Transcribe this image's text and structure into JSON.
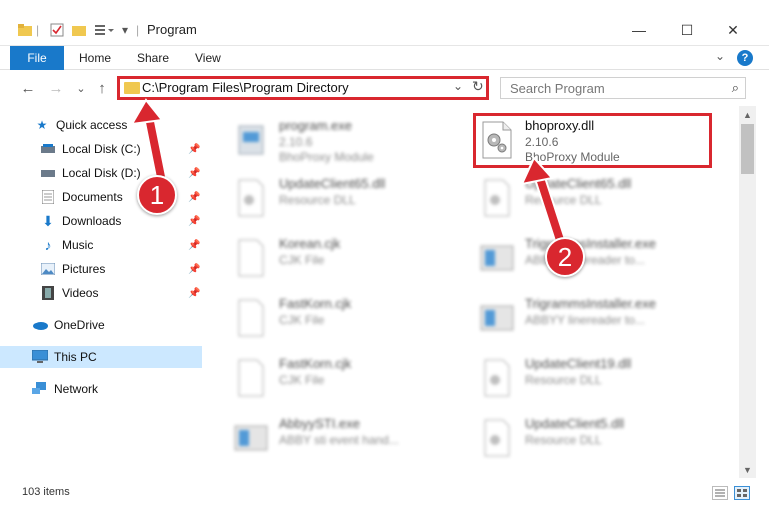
{
  "window": {
    "title": "Program",
    "minimize": "—",
    "maximize": "☐",
    "close": "✕"
  },
  "ribbon": {
    "file": "File",
    "home": "Home",
    "share": "Share",
    "view": "View",
    "help": "?",
    "expand": "⌄"
  },
  "navbar": {
    "back": "←",
    "forward": "→",
    "recent": "⌄",
    "up": "↑",
    "path": "C:\\Program Files\\Program Directory",
    "path_chevron": "⌄",
    "refresh": "↻",
    "search_placeholder": "Search Program",
    "search_icon": "⌕"
  },
  "nav_pane": {
    "quick_access": "Quick access",
    "local_c": "Local Disk (C:)",
    "local_d": "Local Disk (D:)",
    "documents": "Documents",
    "downloads": "Downloads",
    "music": "Music",
    "pictures": "Pictures",
    "videos": "Videos",
    "onedrive": "OneDrive",
    "this_pc": "This PC",
    "network": "Network"
  },
  "files": {
    "f1": {
      "name": "program.exe",
      "sub1": "2.10.6",
      "sub2": "BhoProxy Module"
    },
    "f2": {
      "name": "bhoproxy.dll",
      "sub1": "2.10.6",
      "sub2": "BhoProxy Module"
    },
    "f3": {
      "name": "UpdateClient65.dll",
      "sub1": "Resource DLL"
    },
    "f4": {
      "name": "UpdateClient65.dll",
      "sub1": "Resource DLL"
    },
    "f5": {
      "name": "Korean.cjk",
      "sub1": "CJK File"
    },
    "f6": {
      "name": "TrigrammsInstaller.exe",
      "sub1": "ABBYY linereader to..."
    },
    "f7": {
      "name": "FastKorn.cjk",
      "sub1": "CJK File"
    },
    "f8": {
      "name": "TrigrammsInstaller.exe",
      "sub1": "ABBYY linereader to..."
    },
    "f9": {
      "name": "FastKorn.cjk",
      "sub1": "CJK File"
    },
    "f10": {
      "name": "UpdateClient19.dll",
      "sub1": "Resource DLL"
    },
    "f11": {
      "name": "AbbyySTI.exe",
      "sub1": "ABBY sti event hand..."
    },
    "f12": {
      "name": "UpdateClient5.dll",
      "sub1": "Resource DLL"
    }
  },
  "status": {
    "count": "103 items"
  },
  "annotations": {
    "step1": "1",
    "step2": "2",
    "color": "#d9272f"
  }
}
